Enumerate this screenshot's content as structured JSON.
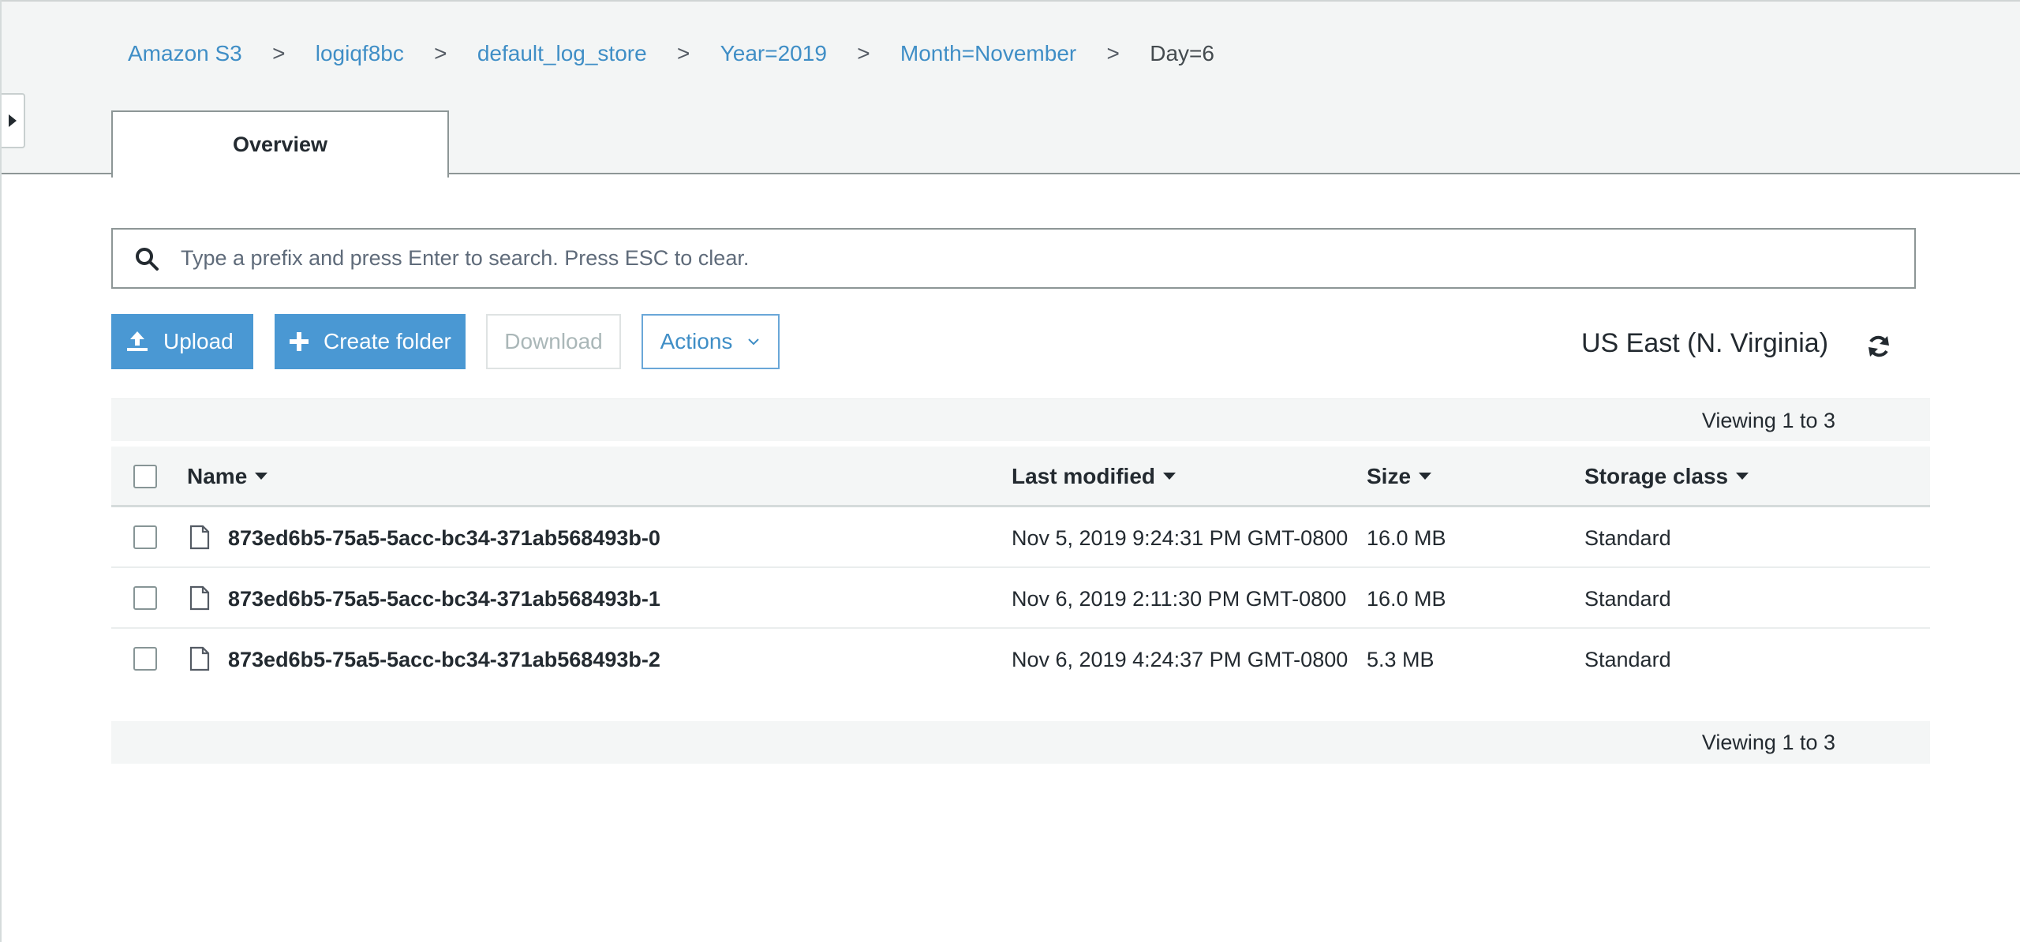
{
  "breadcrumb": {
    "items": [
      {
        "label": "Amazon S3"
      },
      {
        "label": "logiqf8bc"
      },
      {
        "label": "default_log_store"
      },
      {
        "label": "Year=2019"
      },
      {
        "label": "Month=November"
      }
    ],
    "current": "Day=6",
    "separator": ">"
  },
  "tabs": [
    {
      "label": "Overview",
      "active": true
    }
  ],
  "search": {
    "placeholder": "Type a prefix and press Enter to search. Press ESC to clear.",
    "value": ""
  },
  "toolbar": {
    "upload_label": "Upload",
    "create_folder_label": "Create folder",
    "download_label": "Download",
    "actions_label": "Actions"
  },
  "region": "US East (N. Virginia)",
  "pagination": {
    "top_text": "Viewing 1 to 3",
    "bottom_text": "Viewing 1 to 3"
  },
  "table": {
    "columns": {
      "name": "Name",
      "last_modified": "Last modified",
      "size": "Size",
      "storage_class": "Storage class"
    },
    "rows": [
      {
        "name": "873ed6b5-75a5-5acc-bc34-371ab568493b-0",
        "last_modified": "Nov 5, 2019 9:24:31 PM GMT-0800",
        "size": "16.0 MB",
        "storage_class": "Standard"
      },
      {
        "name": "873ed6b5-75a5-5acc-bc34-371ab568493b-1",
        "last_modified": "Nov 6, 2019 2:11:30 PM GMT-0800",
        "size": "16.0 MB",
        "storage_class": "Standard"
      },
      {
        "name": "873ed6b5-75a5-5acc-bc34-371ab568493b-2",
        "last_modified": "Nov 6, 2019 4:24:37 PM GMT-0800",
        "size": "5.3 MB",
        "storage_class": "Standard"
      }
    ]
  },
  "icons": {
    "side_toggle": "caret-right-icon",
    "search": "search-icon",
    "upload": "upload-icon",
    "create_folder": "plus-icon",
    "actions_dropdown": "chevron-down-icon",
    "refresh": "refresh-icon",
    "file": "file-icon",
    "sort": "sort-caret-icon"
  },
  "colors": {
    "link": "#3f8ec6",
    "primary_button": "#4a98d3",
    "header_band": "#f3f5f5",
    "disabled_text": "#aab7b8"
  }
}
